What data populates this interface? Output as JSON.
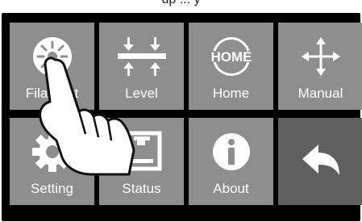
{
  "header": {
    "caption": "up ... y"
  },
  "menu": {
    "tiles": [
      {
        "label": "Filament",
        "icon": "filament-wheel-icon"
      },
      {
        "label": "Level",
        "icon": "level-arrows-icon"
      },
      {
        "label": "Home",
        "icon": "home-badge-icon"
      },
      {
        "label": "Manual",
        "icon": "move-arrows-icon"
      },
      {
        "label": "Setting",
        "icon": "gear-icon"
      },
      {
        "label": "Status",
        "icon": "printer-status-icon"
      },
      {
        "label": "About",
        "icon": "info-icon"
      },
      {
        "label": "",
        "icon": "back-arrow-icon"
      }
    ]
  },
  "colors": {
    "tile": "#8e8e8e",
    "tile_dark": "#5f5f5f",
    "screen_bg": "#000000"
  },
  "overlay": {
    "icon": "pointing-hand-icon"
  }
}
